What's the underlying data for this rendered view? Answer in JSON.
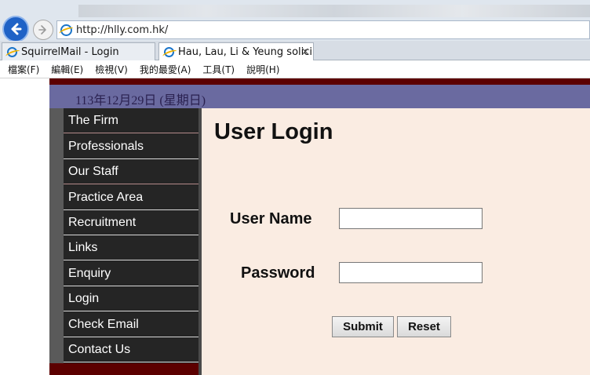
{
  "browser": {
    "address": "http://hlly.com.hk/",
    "tabs": [
      {
        "label": "SquirrelMail - Login"
      },
      {
        "label": "Hau, Lau, Li & Yeung solici..."
      }
    ],
    "tab_close": "×",
    "menu": [
      "檔案(F)",
      "編輯(E)",
      "檢視(V)",
      "我的最愛(A)",
      "工具(T)",
      "說明(H)"
    ]
  },
  "site": {
    "date": "113年12月29日 (星期日)",
    "nav": [
      "The Firm",
      "Professionals",
      "Our Staff",
      "Practice Area",
      "Recruitment",
      "Links",
      "Enquiry",
      "Login",
      "Check Email",
      "Contact Us"
    ]
  },
  "login": {
    "title": "User Login",
    "username_label": "User Name",
    "password_label": "Password",
    "username_value": "",
    "password_value": "",
    "submit_label": "Submit",
    "reset_label": "Reset"
  }
}
